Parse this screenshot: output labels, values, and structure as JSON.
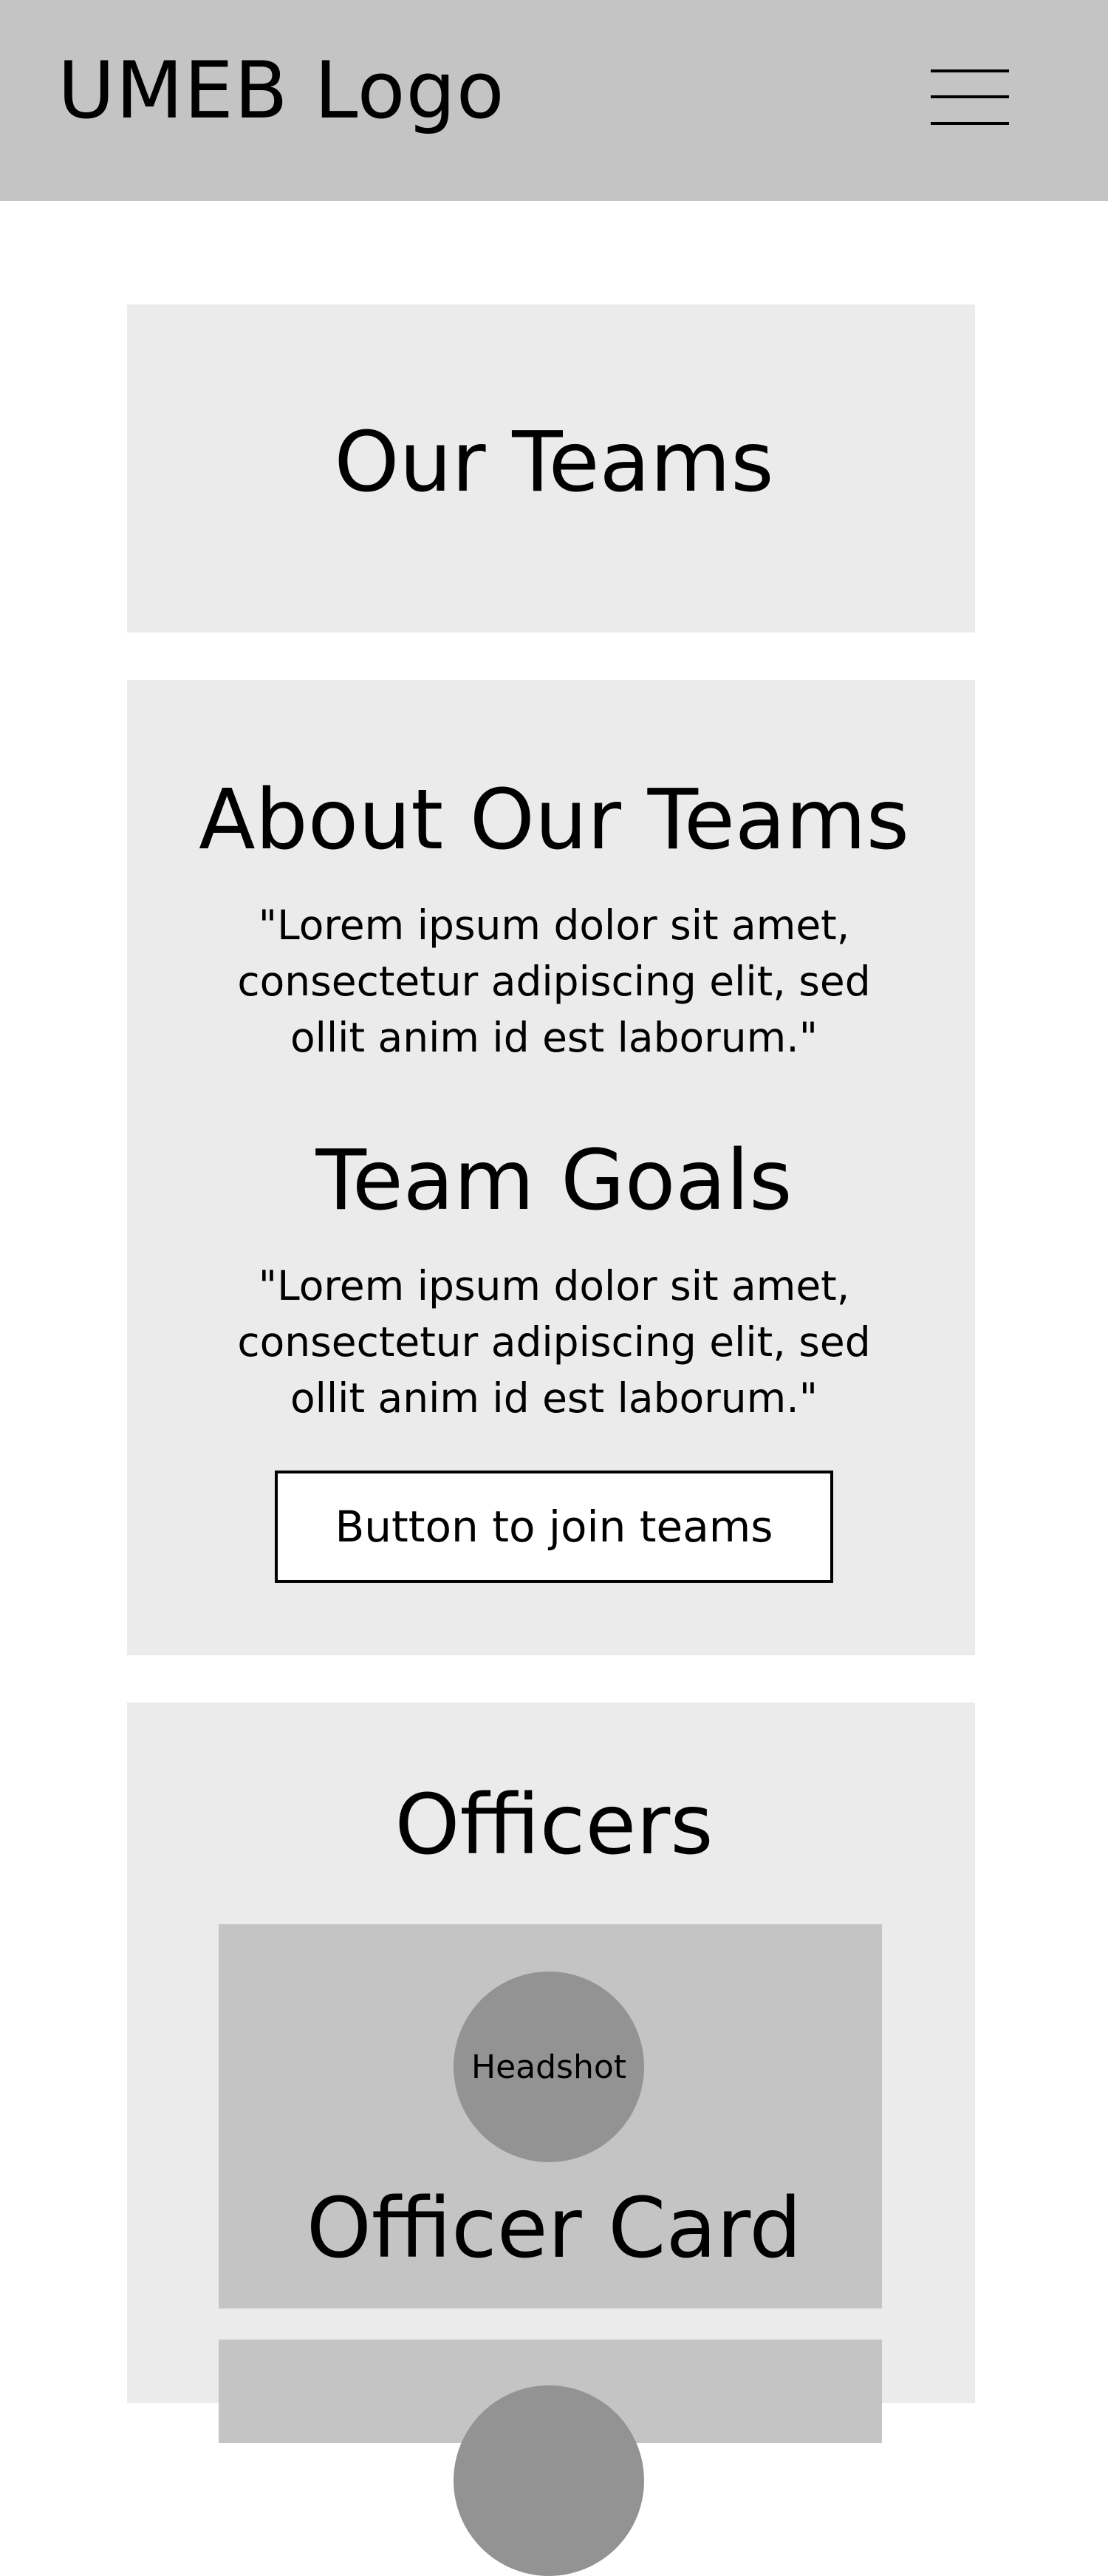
{
  "header": {
    "logo_text": "UMEB Logo",
    "menu_icon": "hamburger-menu-icon"
  },
  "page": {
    "title": "Our Teams"
  },
  "about": {
    "heading": "About Our Teams",
    "text_line1": "\"Lorem ipsum dolor sit amet,",
    "text_line2": "consectetur adipiscing elit, sed",
    "text_line3": "ollit anim id est laborum.\""
  },
  "goals": {
    "heading": "Team Goals",
    "text_line1": "\"Lorem ipsum dolor sit amet,",
    "text_line2": "consectetur adipiscing elit, sed",
    "text_line3": "ollit anim id est laborum.\"",
    "join_button_label": "Button to join teams"
  },
  "officers": {
    "heading": "Officers",
    "cards": [
      {
        "headshot_label": "Headshot",
        "title": "Officer Card"
      },
      {
        "headshot_label": "",
        "title": ""
      }
    ]
  },
  "colors": {
    "header_bg": "#c4c4c4",
    "panel_bg": "#ebebeb",
    "card_bg": "#c4c4c4",
    "headshot_bg": "#939393"
  }
}
